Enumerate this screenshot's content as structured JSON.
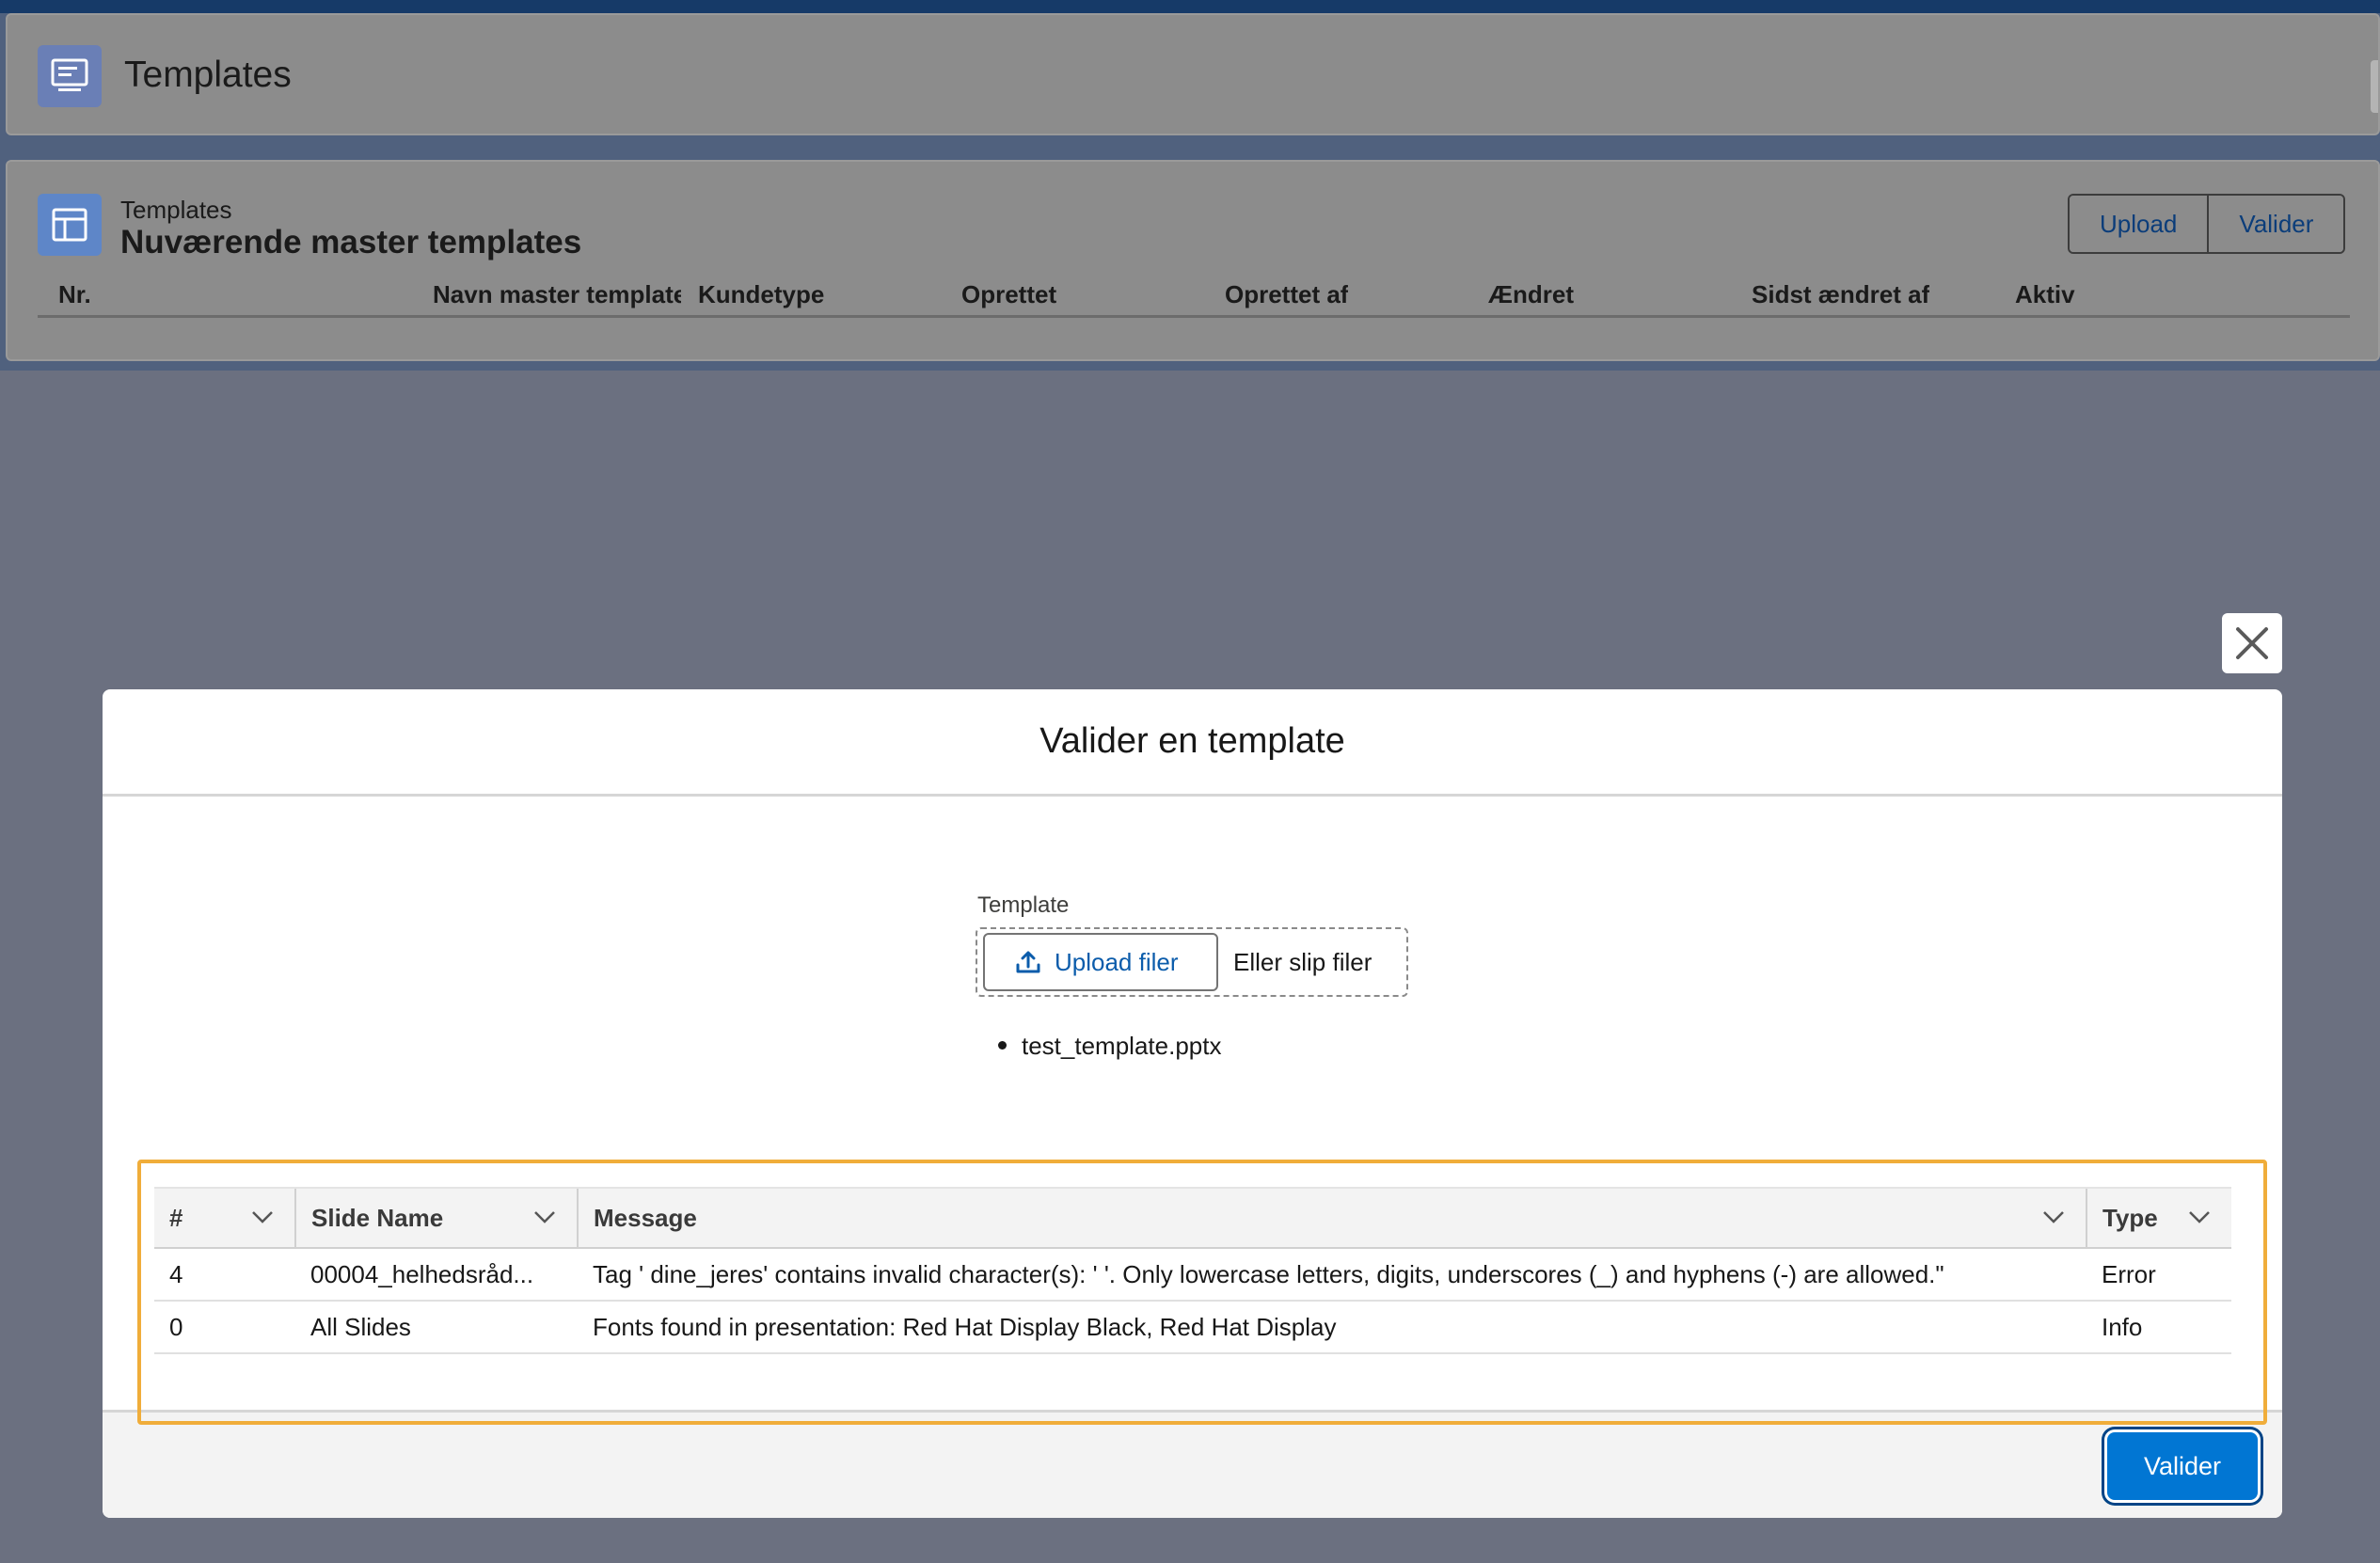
{
  "page_header": {
    "title": "Templates",
    "icon": "template-icon"
  },
  "list_card": {
    "eyebrow": "Templates",
    "title": "Nuværende master templates",
    "actions": {
      "upload": "Upload",
      "validate": "Valider"
    },
    "columns": [
      "Nr.",
      "Navn master template",
      "Kundetype",
      "Oprettet",
      "Oprettet af",
      "Ændret",
      "Sidst ændret af",
      "Aktiv"
    ]
  },
  "modal": {
    "title": "Valider en template",
    "field_label": "Template",
    "upload_button": "Upload filer",
    "drop_text": "Eller slip filer",
    "files": [
      "test_template.pptx"
    ],
    "table": {
      "columns": [
        "#",
        "Slide Name",
        "Message",
        "Type"
      ],
      "rows": [
        {
          "num": "4",
          "slide": "00004_helhedsråd...",
          "message": "Tag ' dine_jeres' contains invalid character(s): ' '. Only lowercase letters, digits, underscores (_) and hyphens (-) are allowed.\"",
          "type": "Error"
        },
        {
          "num": "0",
          "slide": "All Slides",
          "message": "Fonts found in presentation: Red Hat Display Black, Red Hat Display",
          "type": "Info"
        }
      ]
    },
    "submit": "Valider"
  },
  "colors": {
    "brand": "#0176d3",
    "highlight": "#f0ad3a"
  }
}
